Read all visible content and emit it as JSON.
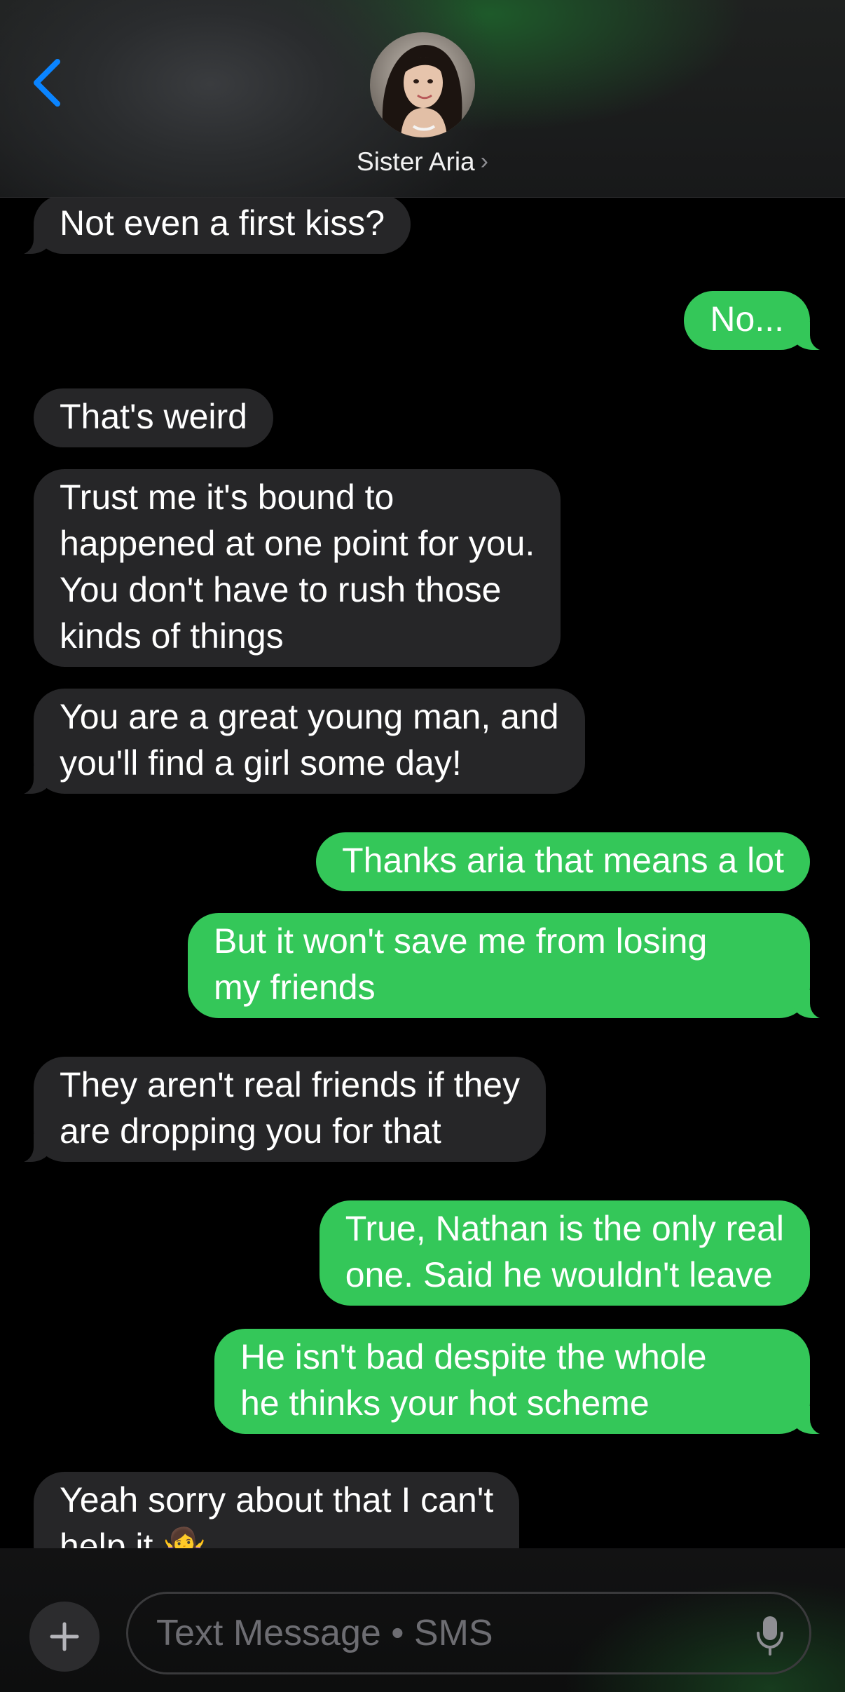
{
  "header": {
    "contact_name": "Sister Aria",
    "back_icon": "chevron-left-icon",
    "chevron_icon": "chevron-right-icon"
  },
  "messages": [
    {
      "side": "in",
      "text": "Not even a first kiss?"
    },
    {
      "side": "out",
      "text": "No..."
    },
    {
      "side": "in",
      "text": "That's weird"
    },
    {
      "side": "in",
      "text": "Trust me it's bound to\nhappened at one point for you.\nYou don't have to rush those\nkinds of things"
    },
    {
      "side": "in",
      "text": "You are a great young man, and\nyou'll find a girl some day!"
    },
    {
      "side": "out",
      "text": "Thanks aria that means a lot"
    },
    {
      "side": "out",
      "text": "But it won't save me from losing\nmy friends"
    },
    {
      "side": "in",
      "text": "They aren't real friends if they\nare dropping you for that"
    },
    {
      "side": "out",
      "text": "True, Nathan is the only real\none. Said he wouldn't leave"
    },
    {
      "side": "out",
      "text": "He isn't bad despite the whole\nhe thinks your hot scheme"
    },
    {
      "side": "in",
      "text": "Yeah sorry about that I can't\nhelp it 🤷‍♀️"
    }
  ],
  "composer": {
    "placeholder": "Text Message • SMS",
    "plus_icon": "plus-icon",
    "mic_icon": "microphone-icon"
  },
  "colors": {
    "incoming_bubble": "#262628",
    "outgoing_bubble": "#34c759",
    "accent": "#0a84ff"
  }
}
